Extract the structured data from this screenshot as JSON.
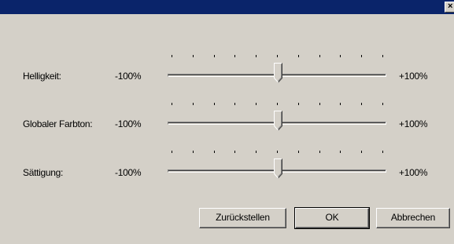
{
  "window": {
    "title": "",
    "close_icon": "close-icon",
    "close_glyph": "×"
  },
  "sliders": [
    {
      "label": "Helligkeit:",
      "min_label": "-100%",
      "max_label": "+100%",
      "value": 0,
      "min": -100,
      "max": 100
    },
    {
      "label": "Globaler Farbton:",
      "min_label": "-100%",
      "max_label": "+100%",
      "value": 0,
      "min": -100,
      "max": 100
    },
    {
      "label": "Sättigung:",
      "min_label": "-100%",
      "max_label": "+100%",
      "value": 0,
      "min": -100,
      "max": 100
    }
  ],
  "buttons": {
    "reset_label": "Zurückstellen",
    "ok_label": "OK",
    "cancel_label": "Abbrechen"
  },
  "colors": {
    "titlebar": "#0a246a",
    "face": "#d4d0c8"
  }
}
